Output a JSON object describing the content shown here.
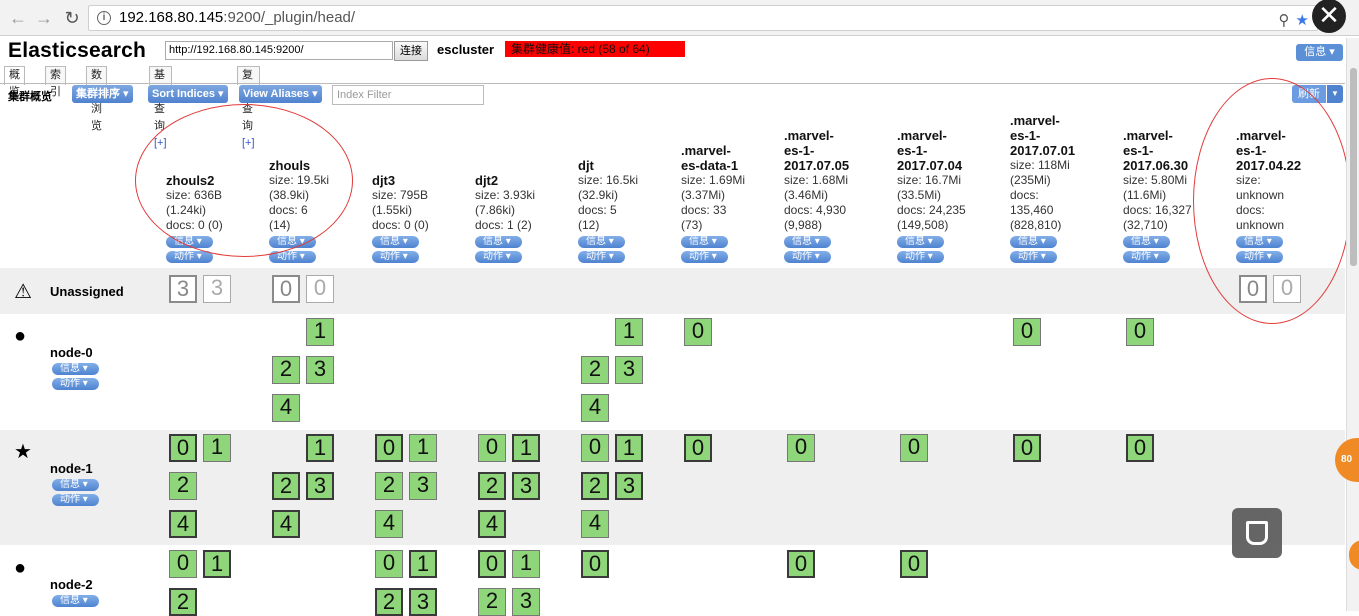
{
  "browser": {
    "url_host": "192.168.80.145",
    "url_rest": ":9200/_plugin/head/",
    "back_icon": "arrow-left-icon",
    "forward_icon": "arrow-right-icon",
    "reload_icon": "reload-icon",
    "close_icon": "close-icon"
  },
  "header": {
    "title": "Elasticsearch",
    "connect_url": "http://192.168.80.145:9200/",
    "connect_label": "连接",
    "cluster_name": "escluster",
    "health": "集群健康值: red (58 of 64)",
    "info_label": "信息"
  },
  "tabs": [
    {
      "label": "概览"
    },
    {
      "label": "索引"
    },
    {
      "label": "数据浏览"
    },
    {
      "label": "基本查询",
      "plus": "[+]"
    },
    {
      "label": "复合查询",
      "plus": "[+]"
    }
  ],
  "toolbar": {
    "label": "集群概览",
    "sort_cluster": "集群排序",
    "sort_indices": "Sort Indices",
    "view_aliases": "View Aliases",
    "index_filter_placeholder": "Index Filter",
    "refresh": "刷新"
  },
  "pill_labels": {
    "info": "信息",
    "action": "动作"
  },
  "indices": [
    {
      "name": [
        "zhouls2"
      ],
      "stats": [
        "size: 636B",
        "(1.24ki)",
        "docs: 0 (0)"
      ]
    },
    {
      "name": [
        "zhouls"
      ],
      "stats": [
        "size: 19.5ki",
        "(38.9ki)",
        "docs: 6",
        "(14)"
      ]
    },
    {
      "name": [
        "djt3"
      ],
      "stats": [
        "size: 795B",
        "(1.55ki)",
        "docs: 0 (0)"
      ]
    },
    {
      "name": [
        "djt2"
      ],
      "stats": [
        "size: 3.93ki",
        "(7.86ki)",
        "docs: 1 (2)"
      ]
    },
    {
      "name": [
        "djt"
      ],
      "stats": [
        "size: 16.5ki",
        "(32.9ki)",
        "docs: 5",
        "(12)"
      ]
    },
    {
      "name": [
        ".marvel-",
        "es-data-1"
      ],
      "stats": [
        "size: 1.69Mi",
        "(3.37Mi)",
        "docs: 33",
        "(73)"
      ]
    },
    {
      "name": [
        ".marvel-",
        "es-1-",
        "2017.07.05"
      ],
      "stats": [
        "size: 1.68Mi",
        "(3.46Mi)",
        "docs: 4,930",
        "(9,988)"
      ]
    },
    {
      "name": [
        ".marvel-",
        "es-1-",
        "2017.07.04"
      ],
      "stats": [
        "size: 16.7Mi",
        "(33.5Mi)",
        "docs: 24,235",
        "(149,508)"
      ]
    },
    {
      "name": [
        ".marvel-",
        "es-1-",
        "2017.07.01"
      ],
      "stats": [
        "size: 118Mi",
        "(235Mi)",
        "docs:",
        "135,460",
        "(828,810)"
      ]
    },
    {
      "name": [
        ".marvel-",
        "es-1-",
        "2017.06.30"
      ],
      "stats": [
        "size: 5.80Mi",
        "(11.6Mi)",
        "docs: 16,327",
        "(32,710)"
      ]
    },
    {
      "name": [
        ".marvel-",
        "es-1-",
        "2017.04.22"
      ],
      "stats": [
        "size:",
        "unknown",
        "docs:",
        "unknown"
      ]
    }
  ],
  "rows": [
    {
      "label": "Unassigned",
      "icon": "warning-icon",
      "symbol": "⚠"
    },
    {
      "label": "node-0",
      "icon": "circle-icon",
      "symbol": "●"
    },
    {
      "label": "node-1",
      "icon": "star-icon",
      "symbol": "★"
    },
    {
      "label": "node-2",
      "icon": "circle-icon",
      "symbol": "●"
    }
  ],
  "shards": {
    "unassigned": [
      {
        "col": 0,
        "r": 0,
        "c": 0,
        "v": "3",
        "k": "u"
      },
      {
        "col": 0,
        "r": 0,
        "c": 1,
        "v": "3",
        "k": "ur"
      },
      {
        "col": 1,
        "r": 0,
        "c": 0,
        "v": "0",
        "k": "u"
      },
      {
        "col": 1,
        "r": 0,
        "c": 1,
        "v": "0",
        "k": "ur"
      },
      {
        "col": 10,
        "r": 0,
        "c": 0,
        "v": "0",
        "k": "u"
      },
      {
        "col": 10,
        "r": 0,
        "c": 1,
        "v": "0",
        "k": "ur"
      }
    ],
    "node-0": [
      {
        "col": 1,
        "r": 0,
        "c": 1,
        "v": "1",
        "k": "r"
      },
      {
        "col": 1,
        "r": 1,
        "c": 0,
        "v": "2",
        "k": "r"
      },
      {
        "col": 1,
        "r": 1,
        "c": 1,
        "v": "3",
        "k": "r"
      },
      {
        "col": 1,
        "r": 2,
        "c": 0,
        "v": "4",
        "k": "r"
      },
      {
        "col": 4,
        "r": 0,
        "c": 1,
        "v": "1",
        "k": "r"
      },
      {
        "col": 4,
        "r": 1,
        "c": 0,
        "v": "2",
        "k": "r"
      },
      {
        "col": 4,
        "r": 1,
        "c": 1,
        "v": "3",
        "k": "r"
      },
      {
        "col": 4,
        "r": 2,
        "c": 0,
        "v": "4",
        "k": "r"
      },
      {
        "col": 5,
        "r": 0,
        "c": 0,
        "v": "0",
        "k": "r"
      },
      {
        "col": 8,
        "r": 0,
        "c": 0,
        "v": "0",
        "k": "r"
      },
      {
        "col": 9,
        "r": 0,
        "c": 0,
        "v": "0",
        "k": "r"
      }
    ],
    "node-1": [
      {
        "col": 0,
        "r": 0,
        "c": 0,
        "v": "0",
        "k": "p"
      },
      {
        "col": 0,
        "r": 0,
        "c": 1,
        "v": "1",
        "k": "r"
      },
      {
        "col": 0,
        "r": 1,
        "c": 0,
        "v": "2",
        "k": "r"
      },
      {
        "col": 0,
        "r": 2,
        "c": 0,
        "v": "4",
        "k": "p"
      },
      {
        "col": 1,
        "r": 0,
        "c": 1,
        "v": "1",
        "k": "p"
      },
      {
        "col": 1,
        "r": 1,
        "c": 0,
        "v": "2",
        "k": "p"
      },
      {
        "col": 1,
        "r": 1,
        "c": 1,
        "v": "3",
        "k": "p"
      },
      {
        "col": 1,
        "r": 2,
        "c": 0,
        "v": "4",
        "k": "p"
      },
      {
        "col": 2,
        "r": 0,
        "c": 0,
        "v": "0",
        "k": "p"
      },
      {
        "col": 2,
        "r": 0,
        "c": 1,
        "v": "1",
        "k": "r"
      },
      {
        "col": 2,
        "r": 1,
        "c": 0,
        "v": "2",
        "k": "r"
      },
      {
        "col": 2,
        "r": 1,
        "c": 1,
        "v": "3",
        "k": "r"
      },
      {
        "col": 2,
        "r": 2,
        "c": 0,
        "v": "4",
        "k": "r"
      },
      {
        "col": 3,
        "r": 0,
        "c": 0,
        "v": "0",
        "k": "r"
      },
      {
        "col": 3,
        "r": 0,
        "c": 1,
        "v": "1",
        "k": "p"
      },
      {
        "col": 3,
        "r": 1,
        "c": 0,
        "v": "2",
        "k": "p"
      },
      {
        "col": 3,
        "r": 1,
        "c": 1,
        "v": "3",
        "k": "p"
      },
      {
        "col": 3,
        "r": 2,
        "c": 0,
        "v": "4",
        "k": "p"
      },
      {
        "col": 4,
        "r": 0,
        "c": 0,
        "v": "0",
        "k": "r"
      },
      {
        "col": 4,
        "r": 0,
        "c": 1,
        "v": "1",
        "k": "p"
      },
      {
        "col": 4,
        "r": 1,
        "c": 0,
        "v": "2",
        "k": "p"
      },
      {
        "col": 4,
        "r": 1,
        "c": 1,
        "v": "3",
        "k": "p"
      },
      {
        "col": 4,
        "r": 2,
        "c": 0,
        "v": "4",
        "k": "r"
      },
      {
        "col": 5,
        "r": 0,
        "c": 0,
        "v": "0",
        "k": "p"
      },
      {
        "col": 6,
        "r": 0,
        "c": 0,
        "v": "0",
        "k": "r"
      },
      {
        "col": 7,
        "r": 0,
        "c": 0,
        "v": "0",
        "k": "r"
      },
      {
        "col": 8,
        "r": 0,
        "c": 0,
        "v": "0",
        "k": "p"
      },
      {
        "col": 9,
        "r": 0,
        "c": 0,
        "v": "0",
        "k": "p"
      }
    ],
    "node-2": [
      {
        "col": 0,
        "r": 0,
        "c": 0,
        "v": "0",
        "k": "r"
      },
      {
        "col": 0,
        "r": 0,
        "c": 1,
        "v": "1",
        "k": "p"
      },
      {
        "col": 0,
        "r": 1,
        "c": 0,
        "v": "2",
        "k": "p"
      },
      {
        "col": 2,
        "r": 0,
        "c": 0,
        "v": "0",
        "k": "r"
      },
      {
        "col": 2,
        "r": 0,
        "c": 1,
        "v": "1",
        "k": "p"
      },
      {
        "col": 2,
        "r": 1,
        "c": 0,
        "v": "2",
        "k": "p"
      },
      {
        "col": 2,
        "r": 1,
        "c": 1,
        "v": "3",
        "k": "p"
      },
      {
        "col": 3,
        "r": 0,
        "c": 0,
        "v": "0",
        "k": "p"
      },
      {
        "col": 3,
        "r": 0,
        "c": 1,
        "v": "1",
        "k": "r"
      },
      {
        "col": 3,
        "r": 1,
        "c": 0,
        "v": "2",
        "k": "r"
      },
      {
        "col": 3,
        "r": 1,
        "c": 1,
        "v": "3",
        "k": "r"
      },
      {
        "col": 4,
        "r": 0,
        "c": 0,
        "v": "0",
        "k": "p"
      },
      {
        "col": 6,
        "r": 0,
        "c": 0,
        "v": "0",
        "k": "p"
      },
      {
        "col": 7,
        "r": 0,
        "c": 0,
        "v": "0",
        "k": "p"
      }
    ]
  },
  "float_badge": "80",
  "colors": {
    "health_red": "#ff0000",
    "shard_green": "#8fd67b",
    "pill_blue": "#5b8fd6",
    "annotation_red": "#e23b3b"
  }
}
